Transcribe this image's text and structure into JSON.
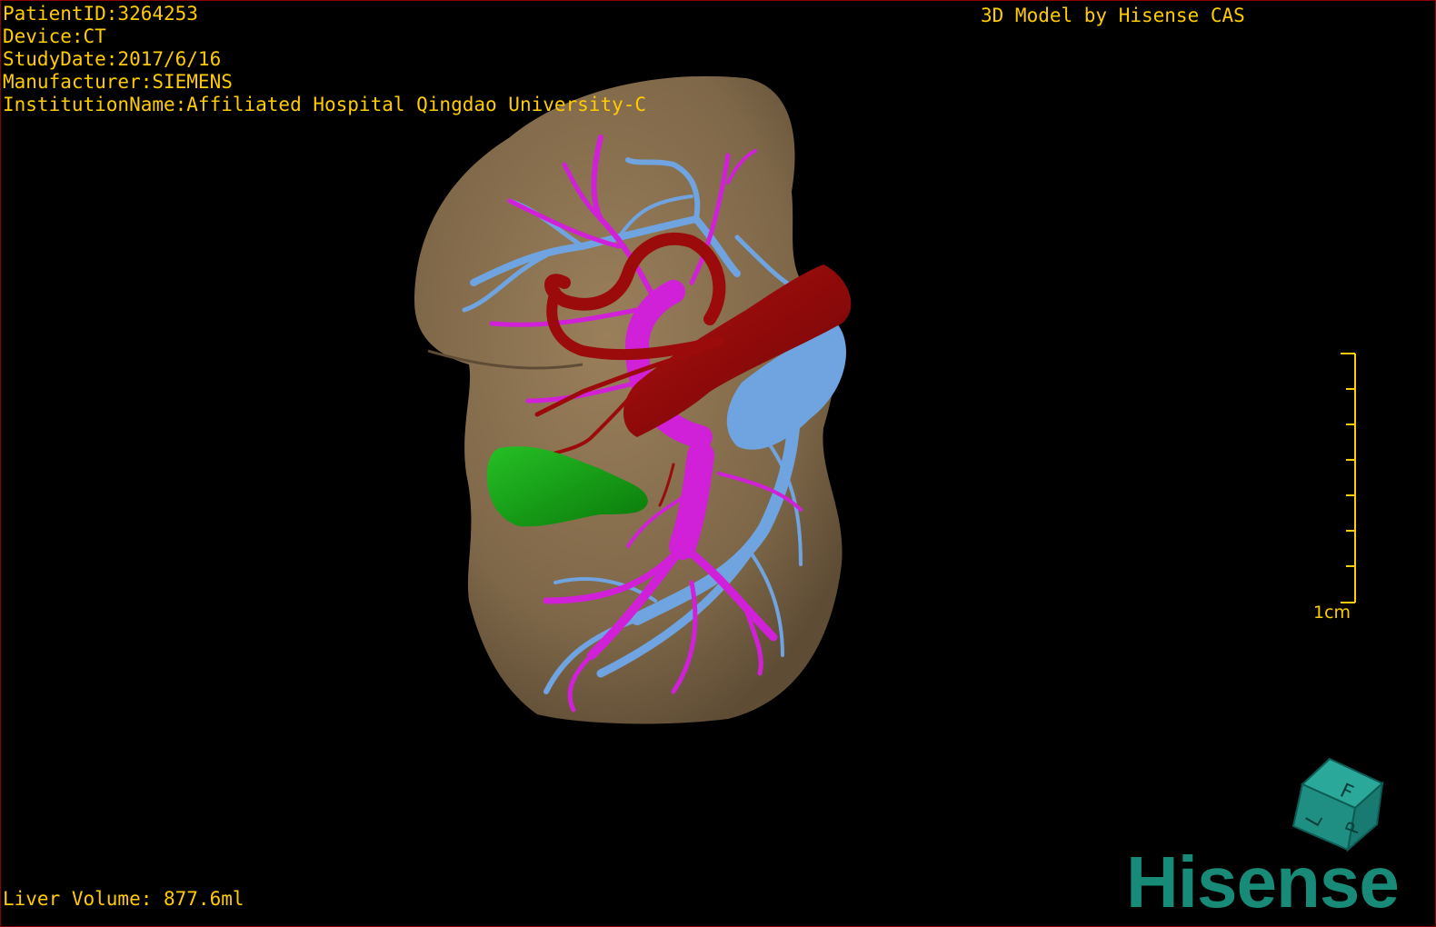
{
  "overlay": {
    "patient_id": "PatientID:3264253",
    "device": "Device:CT",
    "study_date": "StudyDate:2017/6/16",
    "manufacturer": "Manufacturer:SIEMENS",
    "institution": "InstitutionName:Affiliated Hospital Qingdao University-C",
    "model_credit": "3D Model by Hisense CAS",
    "liver_volume": "Liver Volume: 877.6ml"
  },
  "scale": {
    "label": "1cm"
  },
  "orientation_cube": {
    "face_front": "F",
    "face_left": "L",
    "face_right": "P"
  },
  "brand": {
    "name": "Hisense"
  },
  "colors": {
    "text": "#ffcc00",
    "frame": "#8b0000",
    "liver": "#8a7251",
    "portal_vein": "#d020d8",
    "hepatic_vein": "#6fa4e0",
    "artery": "#9b0b0b",
    "gallbladder": "#12a012",
    "brand": "#178a78"
  }
}
